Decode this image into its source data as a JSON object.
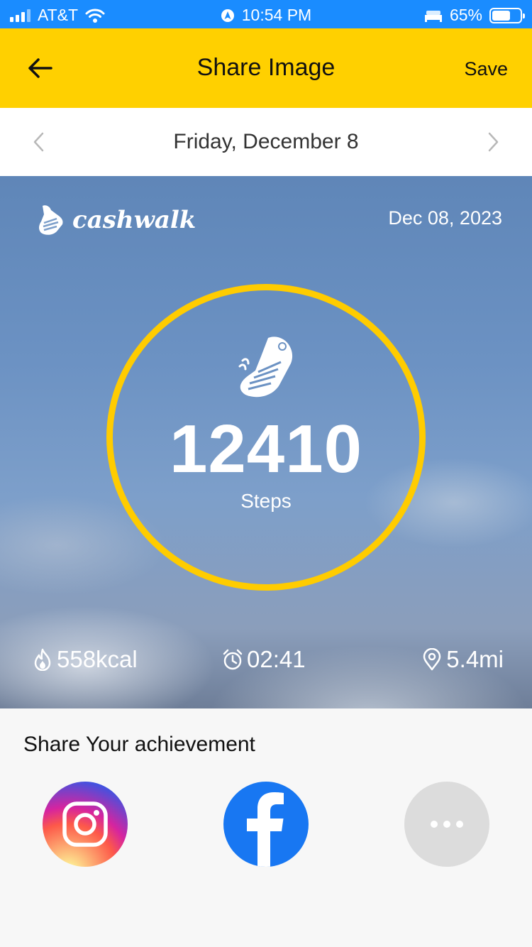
{
  "status_bar": {
    "carrier": "AT&T",
    "time": "10:54 PM",
    "battery": "65%",
    "battery_level": 0.65
  },
  "header": {
    "title": "Share Image",
    "save_label": "Save",
    "back_icon": "arrow-left-icon"
  },
  "date_nav": {
    "label": "Friday, December 8",
    "prev_icon": "chevron-left-icon",
    "next_icon": "chevron-right-icon"
  },
  "card": {
    "brand": "cashwalk",
    "date": "Dec 08, 2023",
    "steps": "12410",
    "steps_label": "Steps",
    "ring_color": "#ffcc00",
    "stats": {
      "calories": "558kcal",
      "duration": "02:41",
      "distance": "5.4mi"
    }
  },
  "share": {
    "title": "Share Your achievement",
    "buttons": [
      {
        "name": "instagram",
        "icon": "instagram-icon"
      },
      {
        "name": "facebook",
        "icon": "facebook-icon"
      },
      {
        "name": "more",
        "icon": "more-dots-icon"
      }
    ]
  },
  "colors": {
    "status_bar": "#1a8cff",
    "header": "#ffd000",
    "facebook": "#1877f2"
  }
}
